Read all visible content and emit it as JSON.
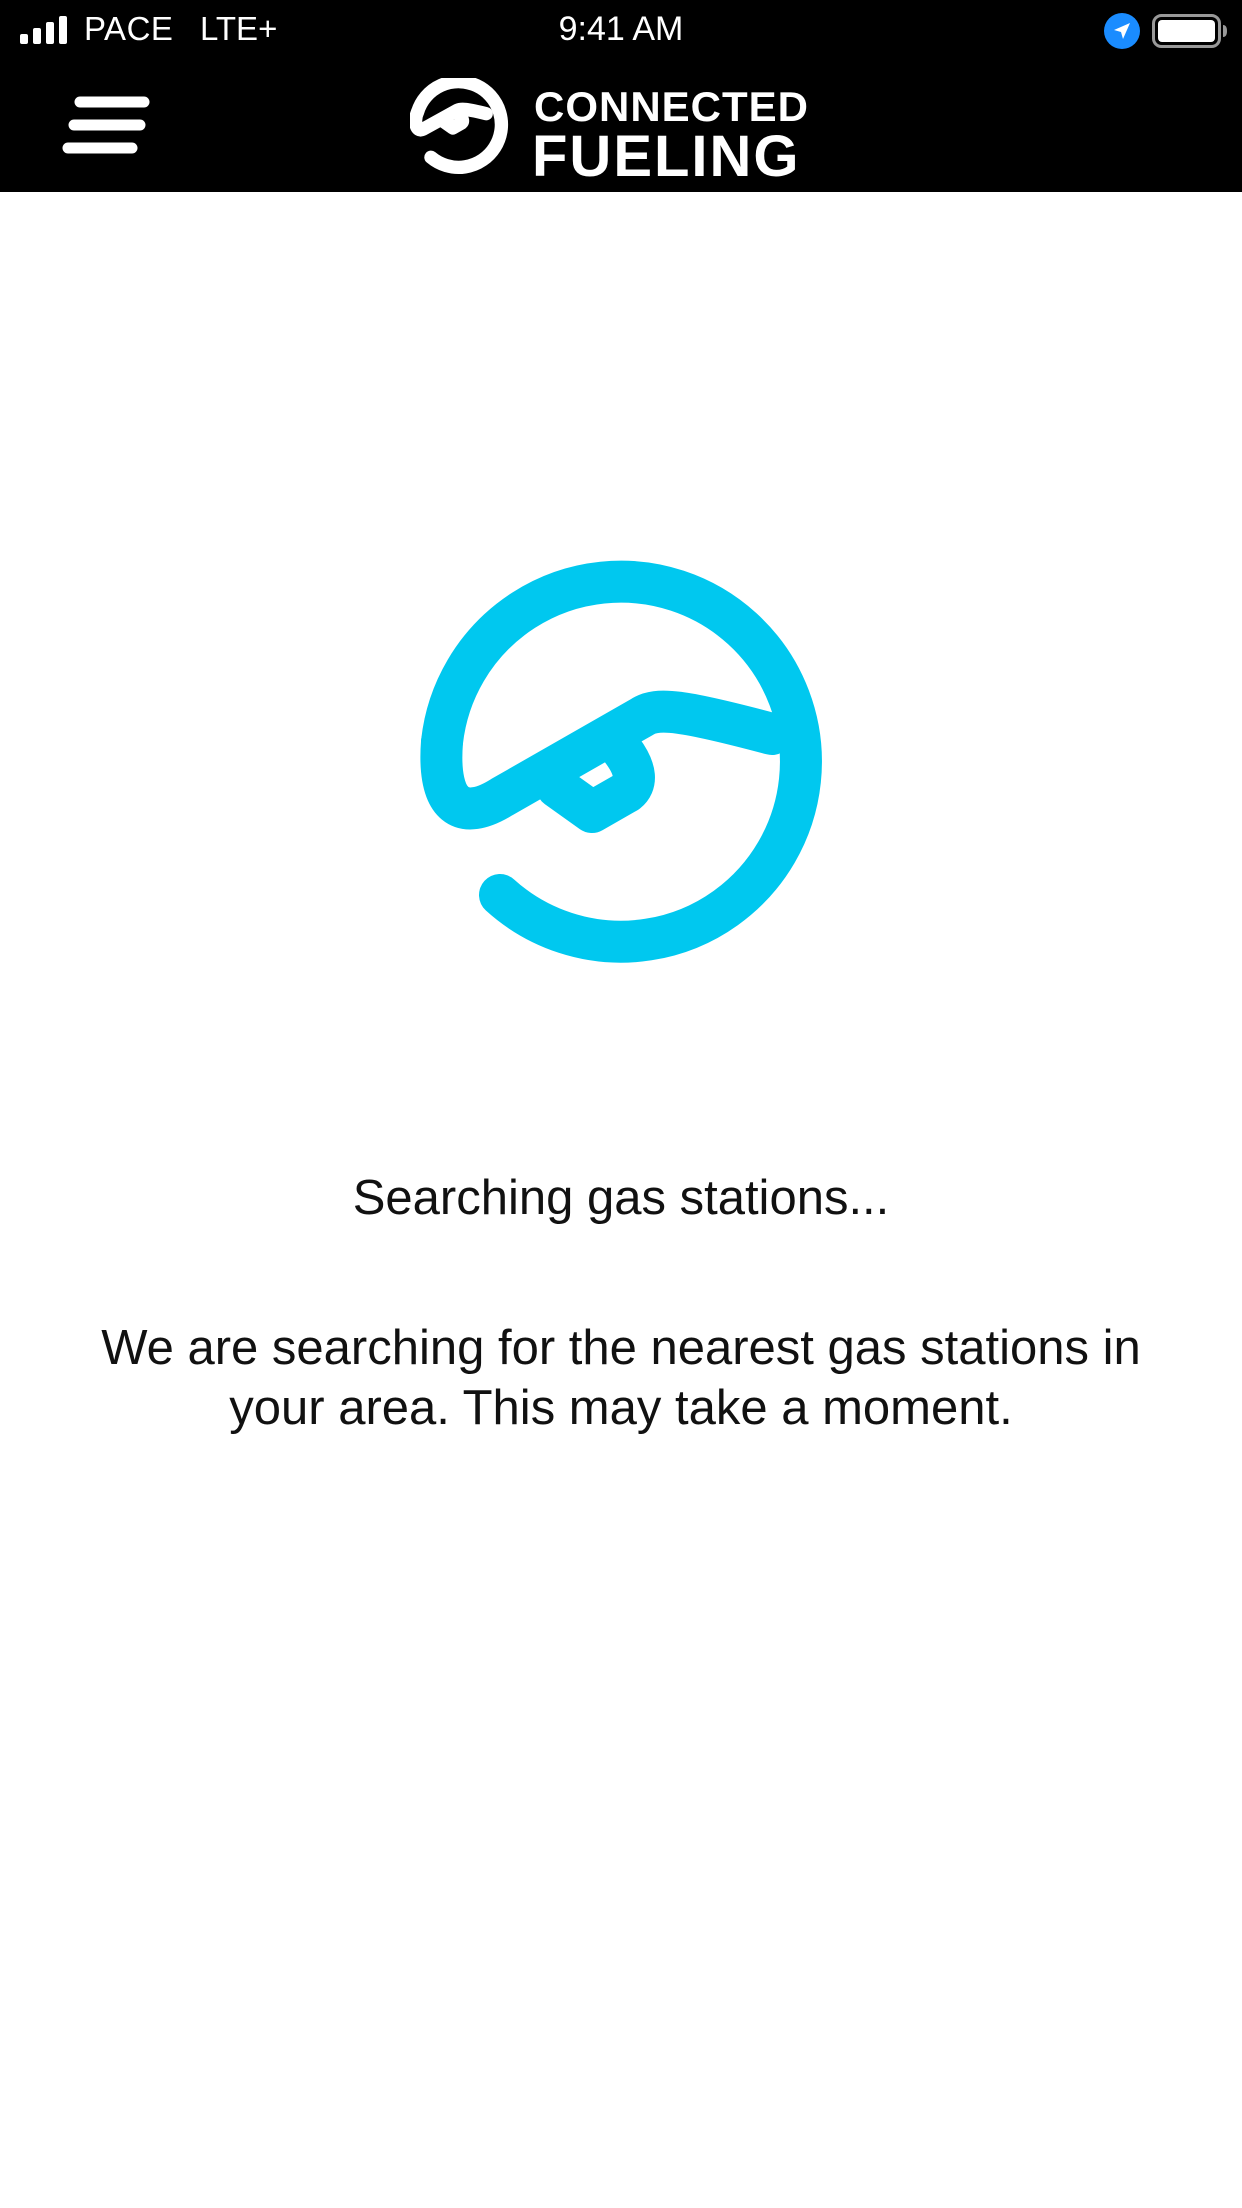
{
  "status_bar": {
    "carrier": "PACE",
    "network": "LTE+",
    "time": "9:41 AM",
    "signal_icon": "cellular-signal-icon",
    "location_icon": "location-arrow-icon",
    "battery_icon": "battery-full-icon",
    "location_color": "#1a8cff"
  },
  "header": {
    "menu_icon": "hamburger-menu-icon",
    "brand_line1": "CONNECTED",
    "brand_line2": "FUELING",
    "brand_logo_icon": "fuel-nozzle-logo-icon"
  },
  "main": {
    "spinner_icon": "fuel-nozzle-loading-icon",
    "accent_color": "#00c8ef",
    "title": "Searching gas stations...",
    "message": "We are searching for the nearest gas stations in your area. This may take a moment."
  }
}
